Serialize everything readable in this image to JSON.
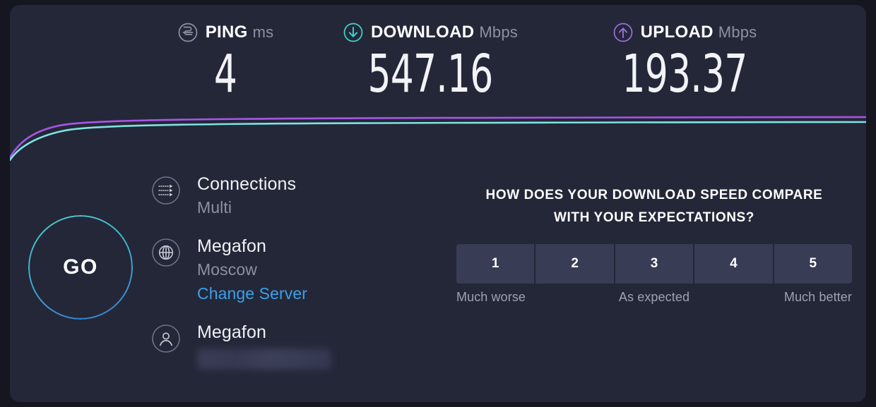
{
  "metrics": [
    {
      "key": "ping",
      "icon": "ping-icon",
      "title": "PING",
      "unit": "ms",
      "value": "4",
      "color": "#8d90a3"
    },
    {
      "key": "download",
      "icon": "download-arrow-icon",
      "title": "DOWNLOAD",
      "unit": "Mbps",
      "value": "547.16",
      "color": "#3dd6c8"
    },
    {
      "key": "upload",
      "icon": "upload-arrow-icon",
      "title": "UPLOAD",
      "unit": "Mbps",
      "value": "193.37",
      "color": "#9b6ce0"
    }
  ],
  "graph": {
    "download_line_color": "#7fe3e0",
    "upload_line_color": "#a855e8"
  },
  "go_button": {
    "label": "GO",
    "ring_gradient_start": "#4fd6cf",
    "ring_gradient_end": "#3a86d6"
  },
  "info": {
    "connections": {
      "icon": "connections-icon",
      "title": "Connections",
      "value": "Multi"
    },
    "server": {
      "icon": "globe-icon",
      "name": "Megafon",
      "location": "Moscow",
      "change_link": "Change Server"
    },
    "account": {
      "icon": "person-icon",
      "name": "Megafon",
      "ip_redacted": true
    }
  },
  "survey": {
    "question_line1": "HOW DOES YOUR DOWNLOAD SPEED COMPARE",
    "question_line2": "WITH YOUR EXPECTATIONS?",
    "ratings": [
      "1",
      "2",
      "3",
      "4",
      "5"
    ],
    "scale_left": "Much worse",
    "scale_mid": "As expected",
    "scale_right": "Much better"
  },
  "colors": {
    "page_background": "#15161f",
    "card_background": "#242738",
    "accent_teal": "#3dd6c8",
    "accent_purple": "#9b6ce0",
    "link_blue": "#3ca0e8"
  }
}
